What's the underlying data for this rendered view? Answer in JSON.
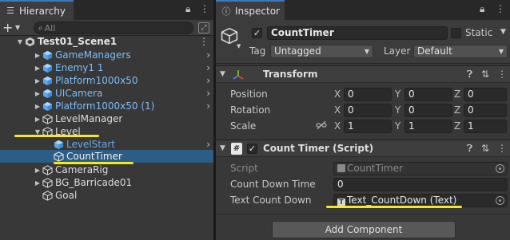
{
  "hierarchy": {
    "tab_title": "Hierarchy",
    "search_placeholder": "All",
    "rows": [
      {
        "label": "Test01_Scene1",
        "style": "bold"
      },
      {
        "label": "GameManagers",
        "style": "blue"
      },
      {
        "label": "Enemy1 1",
        "style": "blue"
      },
      {
        "label": "Platform1000x50",
        "style": "blue"
      },
      {
        "label": "UICamera",
        "style": "blue"
      },
      {
        "label": "Platform1000x50 (1)",
        "style": "blue"
      },
      {
        "label": "LevelManager",
        "style": "white"
      },
      {
        "label": "Level",
        "style": "white"
      },
      {
        "label": "LevelStart",
        "style": "blue"
      },
      {
        "label": "CountTimer",
        "style": "white",
        "selected": true
      },
      {
        "label": "CameraRig",
        "style": "white"
      },
      {
        "label": "BG_Barricade01",
        "style": "white"
      },
      {
        "label": "Goal",
        "style": "white"
      }
    ]
  },
  "inspector": {
    "tab_title": "Inspector",
    "object": {
      "name": "CountTimer",
      "active": true,
      "static_label": "Static",
      "tag_label": "Tag",
      "tag_value": "Untagged",
      "layer_label": "Layer",
      "layer_value": "Default"
    },
    "transform": {
      "title": "Transform",
      "position": {
        "label": "Position",
        "x": "0",
        "y": "0",
        "z": "0"
      },
      "rotation": {
        "label": "Rotation",
        "x": "0",
        "y": "0",
        "z": "0"
      },
      "scale": {
        "label": "Scale",
        "x": "1",
        "y": "1",
        "z": "1"
      },
      "axis_x": "X",
      "axis_y": "Y",
      "axis_z": "Z"
    },
    "script_component": {
      "title": "Count Timer (Script)",
      "script_label": "Script",
      "script_value": "CountTimer",
      "countdown_label": "Count Down Time",
      "countdown_value": "0",
      "text_label": "Text Count Down",
      "text_value": "Text_CountDown (Text)"
    },
    "add_component_label": "Add Component"
  },
  "colors": {
    "selection": "#2c5d87",
    "prefab_blue": "#7cbdf8",
    "annotation_underline": "#f8e71c",
    "tab_accent": "#3a79bb"
  }
}
